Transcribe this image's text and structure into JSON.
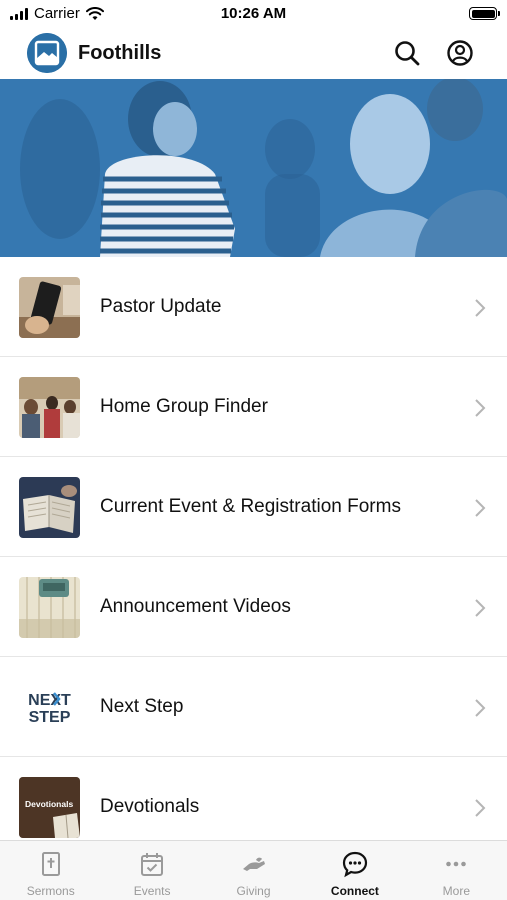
{
  "status_bar": {
    "carrier": "Carrier",
    "time": "10:26 AM"
  },
  "header": {
    "title": "Foothills"
  },
  "menu": [
    {
      "label": "Pastor Update",
      "thumb": "phone-photo"
    },
    {
      "label": "Home Group Finder",
      "thumb": "group-photo"
    },
    {
      "label": "Current Event & Registration Forms",
      "thumb": "bible-photo"
    },
    {
      "label": "Announcement Videos",
      "thumb": "typewriter-photo"
    },
    {
      "label": "Next Step",
      "thumb": "next-step-logo",
      "thumb_text_1": "NEXT",
      "thumb_text_2": "STEP"
    },
    {
      "label": "Devotionals",
      "thumb": "devotionals-photo",
      "thumb_text": "Devotionals"
    }
  ],
  "tabs": [
    {
      "label": "Sermons",
      "icon": "bible-icon"
    },
    {
      "label": "Events",
      "icon": "calendar-icon"
    },
    {
      "label": "Giving",
      "icon": "giving-hand-icon"
    },
    {
      "label": "Connect",
      "icon": "chat-bubble-icon",
      "active": true
    },
    {
      "label": "More",
      "icon": "ellipsis-icon"
    }
  ],
  "colors": {
    "brand_blue": "#2a6fa6",
    "hero_tint": "#3b7fb8",
    "active_tab": "#111111",
    "inactive_tab": "#9a9a9a"
  }
}
